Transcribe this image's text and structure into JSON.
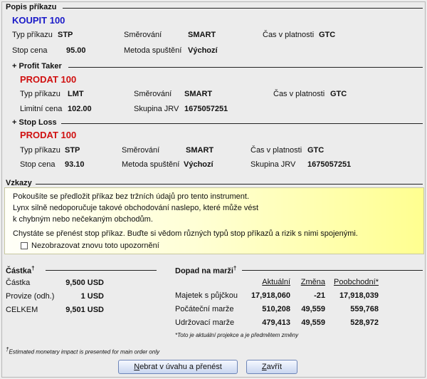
{
  "order_description": {
    "title": "Popis příkazu",
    "main": {
      "action": "KOUPIT 100",
      "order_type_label": "Typ příkazu",
      "order_type_value": "STP",
      "routing_label": "Směrování",
      "routing_value": "SMART",
      "tif_label": "Čas v platnosti",
      "tif_value": "GTC",
      "stop_price_label": "Stop cena",
      "stop_price_value": "95.00",
      "trigger_label": "Metoda spuštění",
      "trigger_value": "Výchozí"
    },
    "profit_taker": {
      "header": "+ Profit Taker",
      "action": "PRODAT 100",
      "order_type_label": "Typ příkazu",
      "order_type_value": "LMT",
      "routing_label": "Směrování",
      "routing_value": "SMART",
      "tif_label": "Čas v platnosti",
      "tif_value": "GTC",
      "limit_price_label": "Limitní cena",
      "limit_price_value": "102.00",
      "group_label": "Skupina JRV",
      "group_value": "1675057251"
    },
    "stop_loss": {
      "header": "+ Stop Loss",
      "action": "PRODAT 100",
      "order_type_label": "Typ příkazu",
      "order_type_value": "STP",
      "routing_label": "Směrování",
      "routing_value": "SMART",
      "tif_label": "Čas v platnosti",
      "tif_value": "GTC",
      "stop_price_label": "Stop cena",
      "stop_price_value": "93.10",
      "trigger_label": "Metoda spuštění",
      "trigger_value": "Výchozí",
      "group_label": "Skupina JRV",
      "group_value": "1675057251"
    }
  },
  "warnings": {
    "title": "Vzkazy",
    "line1": "Pokoušíte se předložit příkaz bez tržních údajů pro tento instrument.",
    "line2": "Lynx silně nedoporučuje takové obchodování naslepo, které může vést",
    "line3": "k chybným nebo nečekaným obchodům.",
    "line4": "Chystáte se přenést stop příkaz. Buďte si vědom různých typů stop příkazů a rizik s nimi spojenými.",
    "dont_show_label": "Nezobrazovat znovu toto upozornění",
    "dont_show_checked": false
  },
  "amount": {
    "title": "Částka",
    "rows": [
      {
        "label": "Částka",
        "value": "9,500 USD"
      },
      {
        "label": "Provize (odh.)",
        "value": "1 USD"
      },
      {
        "label": "CELKEM",
        "value": "9,501 USD"
      }
    ]
  },
  "margin": {
    "title": "Dopad na marži",
    "columns": [
      "Aktuální",
      "Změna",
      "Poobchodní*"
    ],
    "rows": [
      {
        "label": "Majetek s půjčkou",
        "current": "17,918,060",
        "change": "-21",
        "post": "17,918,039"
      },
      {
        "label": "Počáteční marže",
        "current": "510,208",
        "change": "49,559",
        "post": "559,768"
      },
      {
        "label": "Udržovací marže",
        "current": "479,413",
        "change": "49,559",
        "post": "528,972"
      }
    ],
    "note": "*Toto je aktuální projekce a je předmětem změny"
  },
  "footnote": "Estimated monetary impact is presented for main order only",
  "footnote_mark": "†",
  "buttons": {
    "transmit": "Nebrat v úvahu a přenést",
    "transmit_mnemonic": "N",
    "transmit_rest": "ebrat v úvahu a přenést",
    "close": "Zavřít",
    "close_mnemonic": "Z",
    "close_rest": "avřít"
  },
  "colors": {
    "buy": "#1a1ac8",
    "sell": "#d01010",
    "warning_bg": "#ffff90"
  }
}
